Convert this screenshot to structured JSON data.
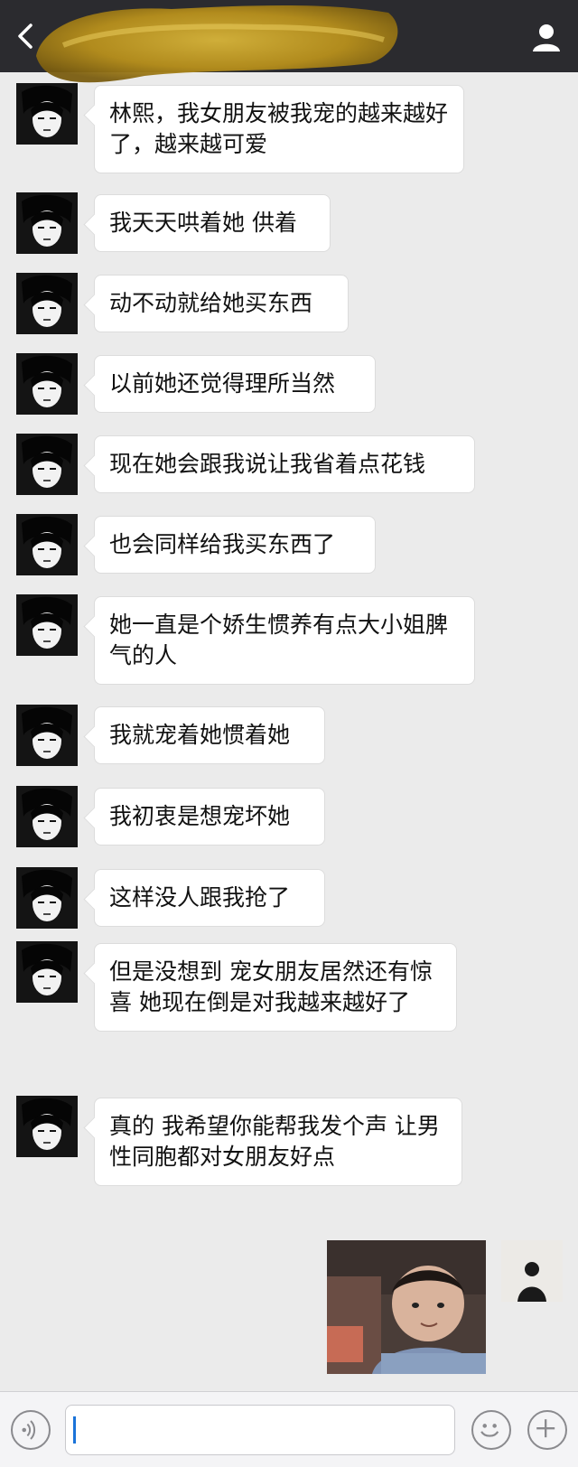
{
  "header": {
    "back_icon": "chevron-left-icon",
    "profile_icon": "user-icon"
  },
  "messages": [
    {
      "text": "林熙，我女朋友被我宠的越来越好了，越来越可爱"
    },
    {
      "text": "我天天哄着她 供着"
    },
    {
      "text": "动不动就给她买东西"
    },
    {
      "text": "以前她还觉得理所当然"
    },
    {
      "text": "现在她会跟我说让我省着点花钱"
    },
    {
      "text": "也会同样给我买东西了"
    },
    {
      "text": "她一直是个娇生惯养有点大小姐脾气的人"
    },
    {
      "text": "我就宠着她惯着她"
    },
    {
      "text": "我初衷是想宠坏她"
    },
    {
      "text": "这样没人跟我抢了"
    },
    {
      "text": "但是没想到 宠女朋友居然还有惊喜 她现在倒是对我越来越好了"
    },
    {
      "text": "真的 我希望你能帮我发个声 让男性同胞都对女朋友好点"
    }
  ],
  "input_bar": {
    "voice_icon": "voice-icon",
    "emoji_icon": "emoji-icon",
    "plus_icon": "plus-icon",
    "input_value": ""
  }
}
